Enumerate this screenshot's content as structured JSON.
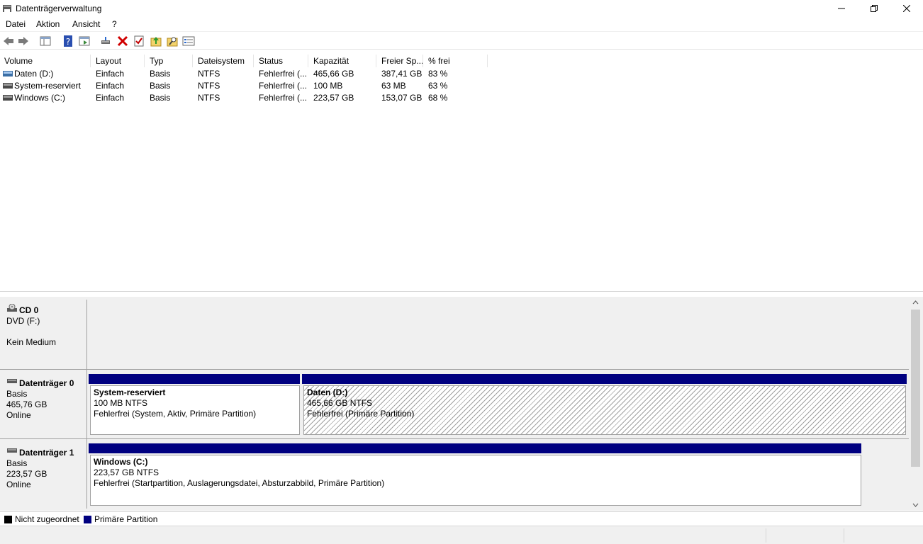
{
  "window": {
    "title": "Datenträgerverwaltung"
  },
  "menu": [
    "Datei",
    "Aktion",
    "Ansicht",
    "?"
  ],
  "toolbar": [
    "back-icon",
    "forward-icon",
    "show-hide-tree-icon",
    "help-icon",
    "properties-icon",
    "connect-icon",
    "delete-icon",
    "check-icon",
    "up-icon",
    "search-icon",
    "console-icon"
  ],
  "volume_list": {
    "columns": [
      "Volume",
      "Layout",
      "Typ",
      "Dateisystem",
      "Status",
      "Kapazität",
      "Freier Sp...",
      "% frei"
    ],
    "rows": [
      {
        "volume": "Daten (D:)",
        "layout": "Einfach",
        "typ": "Basis",
        "fs": "NTFS",
        "status": "Fehlerfrei (...",
        "cap": "465,66 GB",
        "free": "387,41 GB",
        "pct": "83 %"
      },
      {
        "volume": "System-reserviert",
        "layout": "Einfach",
        "typ": "Basis",
        "fs": "NTFS",
        "status": "Fehlerfrei (...",
        "cap": "100 MB",
        "free": "63 MB",
        "pct": "63 %"
      },
      {
        "volume": "Windows (C:)",
        "layout": "Einfach",
        "typ": "Basis",
        "fs": "NTFS",
        "status": "Fehlerfrei (...",
        "cap": "223,57 GB",
        "free": "153,07 GB",
        "pct": "68 %"
      }
    ]
  },
  "disks": {
    "cd0": {
      "name": "CD 0",
      "line1": "DVD (F:)",
      "line2": "Kein Medium"
    },
    "disk0": {
      "name": "Datenträger 0",
      "type": "Basis",
      "size": "465,76 GB",
      "state": "Online",
      "partitions": [
        {
          "name": "System-reserviert",
          "size": "100 MB NTFS",
          "status": "Fehlerfrei (System, Aktiv, Primäre Partition)"
        },
        {
          "name": "Daten  (D:)",
          "size": "465,66 GB NTFS",
          "status": "Fehlerfrei (Primäre Partition)"
        }
      ]
    },
    "disk1": {
      "name": "Datenträger 1",
      "type": "Basis",
      "size": "223,57 GB",
      "state": "Online",
      "partitions": [
        {
          "name": "Windows  (C:)",
          "size": "223,57 GB NTFS",
          "status": "Fehlerfrei (Startpartition, Auslagerungsdatei, Absturzabbild, Primäre Partition)"
        }
      ]
    }
  },
  "legend": [
    {
      "label": "Nicht zugeordnet",
      "color": "#000000"
    },
    {
      "label": "Primäre Partition",
      "color": "#000080"
    }
  ],
  "colors": {
    "partition_bar": "#000080",
    "unallocated": "#000000"
  }
}
